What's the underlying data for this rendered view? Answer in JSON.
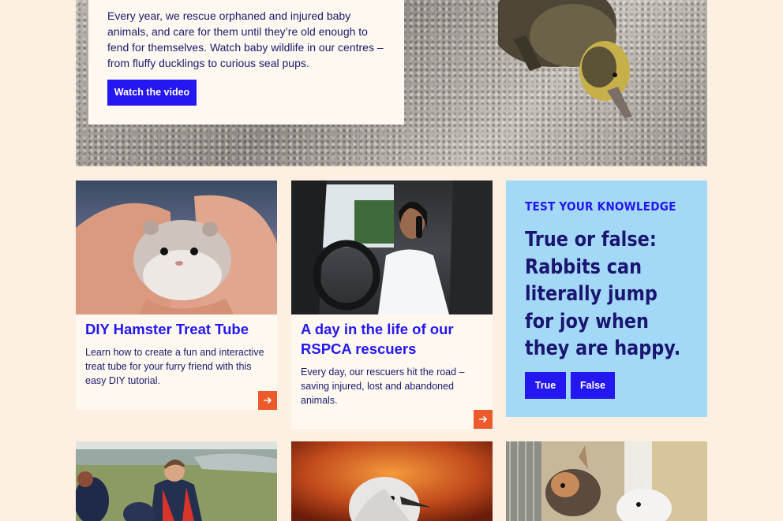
{
  "hero": {
    "text": "Every year, we rescue orphaned and injured baby animals, and care for them until they’re old enough to fend for themselves. Watch baby wildlife in our centres – from fluffy ducklings to curious seal pups.",
    "button_label": "Watch the video"
  },
  "cards": [
    {
      "title": "DIY Hamster Treat Tube",
      "description": "Learn how to create a fun and interactive treat tube for your furry friend with this easy DIY tutorial."
    },
    {
      "title": "A day in the life of our RSPCA rescuers",
      "description": "Every day, our rescuers hit the road – saving injured, lost and abandoned animals."
    }
  ],
  "quiz": {
    "kicker": "TEST YOUR KNOWLEDGE",
    "question": "True or false: Rabbits can literally jump for joy when they are happy.",
    "options": [
      "True",
      "False"
    ]
  },
  "colors": {
    "background": "#fdf0e2",
    "card": "#fef8f1",
    "accent_blue": "#2417f0",
    "navy_text": "#1c1a6b",
    "quiz_bg": "#a3d8f7",
    "arrow_orange": "#ec5a2b"
  }
}
